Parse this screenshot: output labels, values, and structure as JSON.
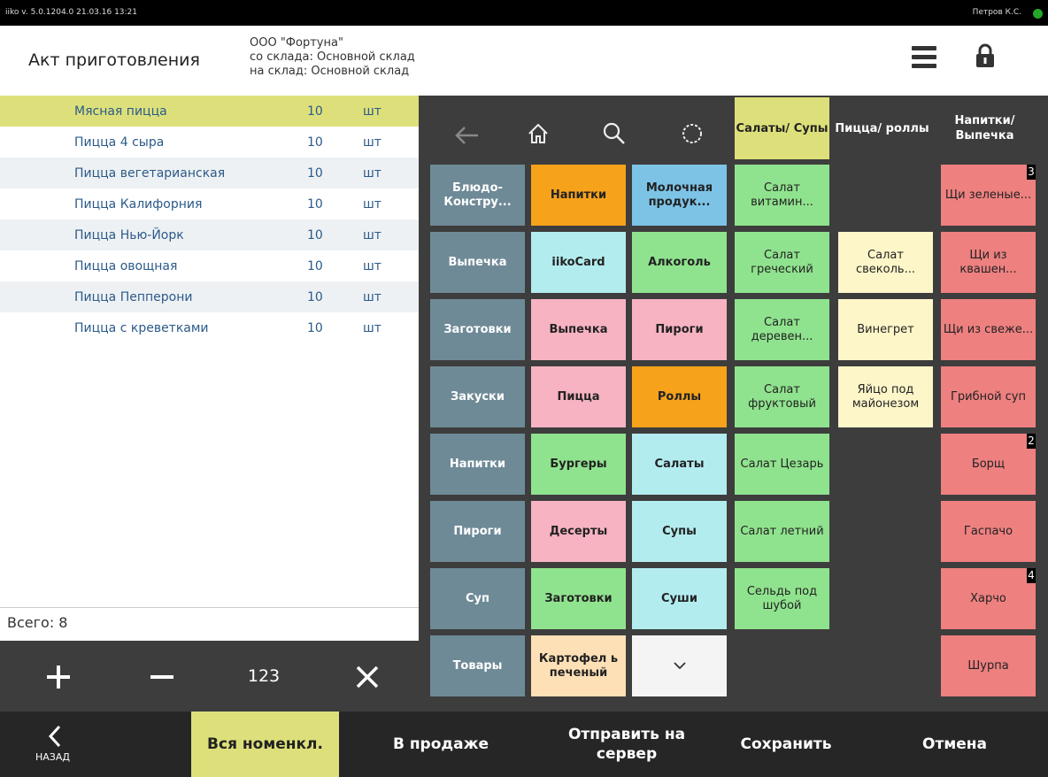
{
  "topbar": {
    "version": "iiko v. 5.0.1204.0   21.03.16  13:21",
    "user": "Петров К.С."
  },
  "header": {
    "title": "Акт приготовления",
    "org": "ООО \"Фортуна\"",
    "from": "со склада: Основной склад",
    "to": "на склад: Основной склад"
  },
  "items": [
    {
      "name": "Мясная пицца",
      "qty": "10",
      "unit": "шт"
    },
    {
      "name": "Пицца 4 сыра",
      "qty": "10",
      "unit": "шт"
    },
    {
      "name": "Пицца вегетарианская",
      "qty": "10",
      "unit": "шт"
    },
    {
      "name": "Пицца Калифорния",
      "qty": "10",
      "unit": "шт"
    },
    {
      "name": "Пицца Нью-Йорк",
      "qty": "10",
      "unit": "шт"
    },
    {
      "name": "Пицца овощная",
      "qty": "10",
      "unit": "шт"
    },
    {
      "name": "Пицца Пепперони",
      "qty": "10",
      "unit": "шт"
    },
    {
      "name": "Пицца с креветками",
      "qty": "10",
      "unit": "шт"
    }
  ],
  "total": "Всего: 8",
  "ops": {
    "numpad": "123"
  },
  "tabs": [
    {
      "label": "Салаты/ Супы"
    },
    {
      "label": "Пицца/ роллы"
    },
    {
      "label": "Напитки/ Выпечка"
    }
  ],
  "groups": [
    "Блюдо-Констру...",
    "Выпечка",
    "Заготовки",
    "Закуски",
    "Напитки",
    "Пироги",
    "Суп",
    "Товары"
  ],
  "cats1": [
    "Напитки",
    "iikoCard",
    "Выпечка",
    "Пицца",
    "Бургеры",
    "Десерты",
    "Заготовки",
    "Картофел ь печеный"
  ],
  "cats2": [
    "Молочная продук...",
    "Алкоголь",
    "Пироги",
    "Роллы",
    "Салаты",
    "Супы",
    "Суши"
  ],
  "salads": [
    "Салат витамин...",
    "Салат греческий",
    "Салат деревен...",
    "Салат фруктовый",
    "Салат Цезарь",
    "Салат летний",
    "Сельдь под шубой"
  ],
  "col2": [
    "Салат свеколь...",
    "Винегрет",
    "Яйцо под майонезом"
  ],
  "soups": [
    "Щи зеленые...",
    "Щи из квашен...",
    "Щи из свеже...",
    "Грибной суп",
    "Борщ",
    "Гаспачо",
    "Харчо",
    "Шурпа"
  ],
  "badges": {
    "b0": "3",
    "b4": "2",
    "b6": "4"
  },
  "bottom": {
    "back": "НАЗАД",
    "all": "Вся номенкл.",
    "sale": "В продаже",
    "send": "Отправить на сервер",
    "save": "Сохранить",
    "cancel": "Отмена"
  },
  "colors": {
    "selected": "#dde07a",
    "orange": "#f7a21b",
    "blue": "#7dc3e6",
    "cyan": "#b3ecef",
    "green": "#90e38e",
    "pink": "#f7b3c2",
    "slate": "#6f8a97",
    "yellow": "#fdf6c9",
    "red": "#ee8080",
    "peach": "#fde0b6"
  }
}
